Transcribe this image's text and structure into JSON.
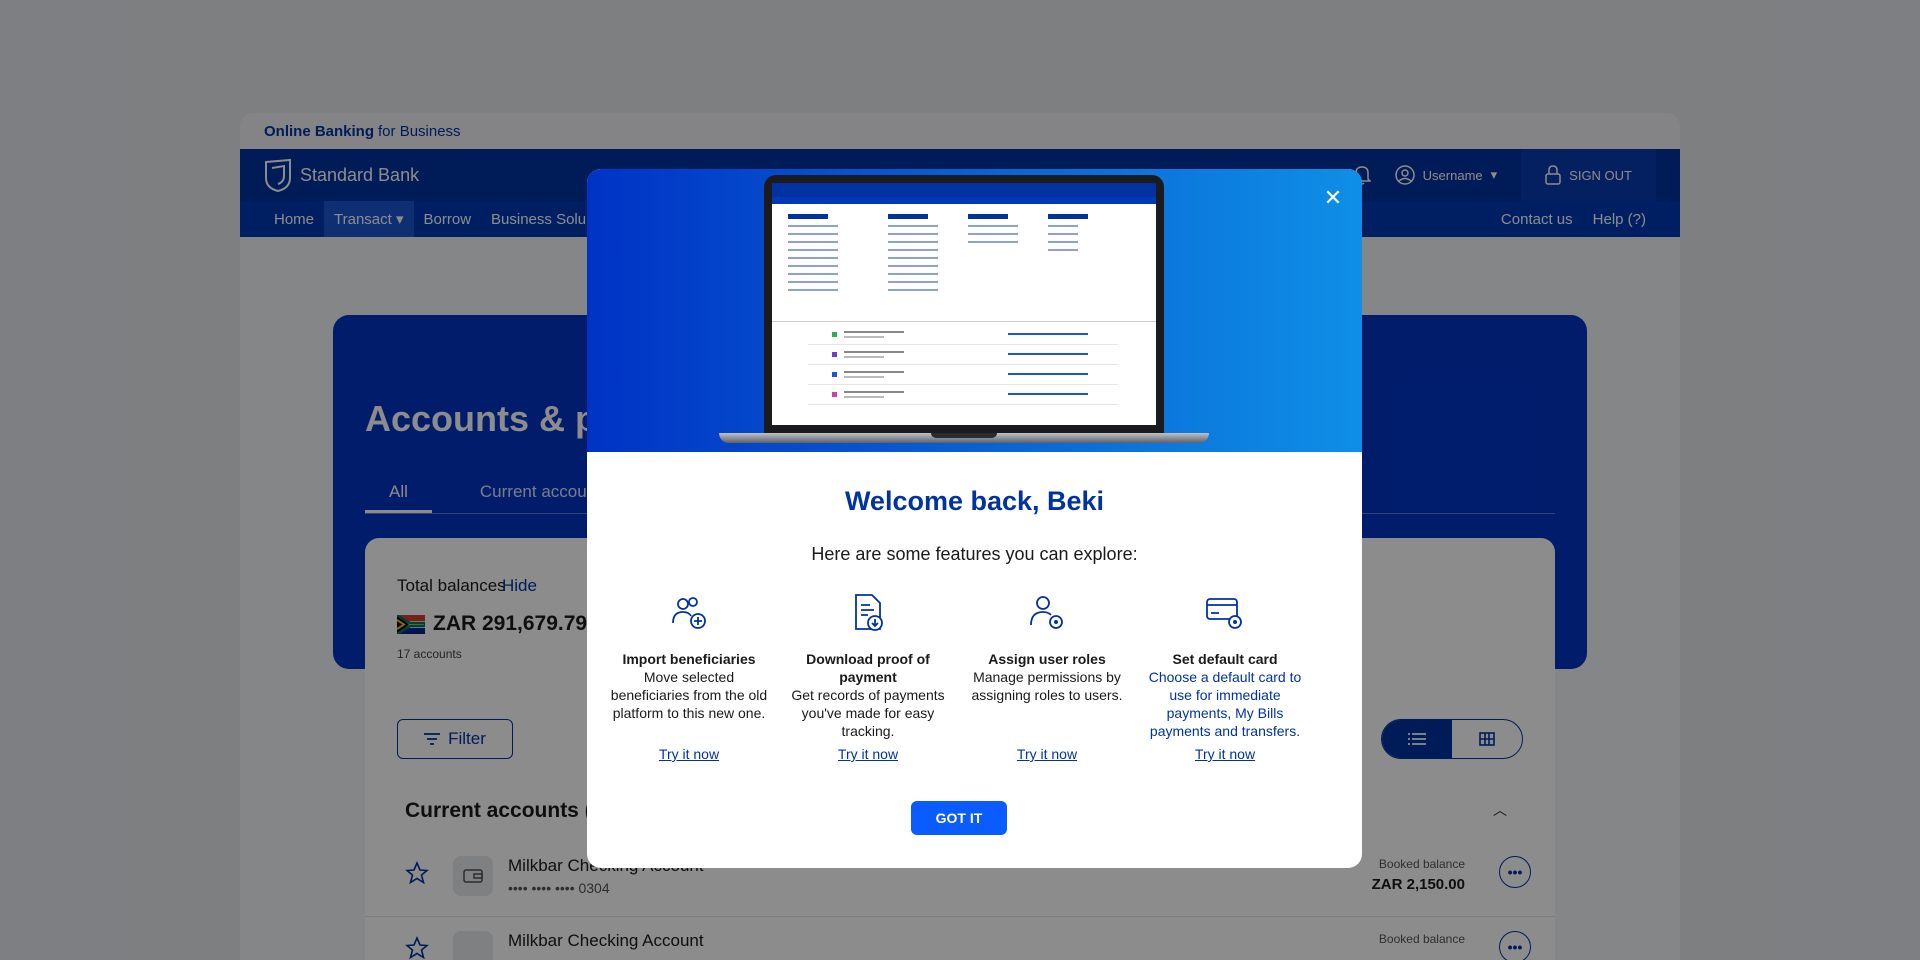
{
  "topstrip": {
    "brand": "Online Banking",
    "suffix": "for Business"
  },
  "header": {
    "bank_name": "Standard Bank",
    "username": "Username",
    "signout": "SIGN OUT"
  },
  "nav": {
    "items": [
      "Home",
      "Transact",
      "Borrow",
      "Business Solu"
    ],
    "right": [
      "Contact us",
      "Help (?)"
    ]
  },
  "page": {
    "title": "Accounts & p",
    "tabs": [
      "All",
      "Current accounts"
    ]
  },
  "balances": {
    "label": "Total balances",
    "hide": "Hide",
    "amount": "ZAR 291,679.79",
    "count": "17 accounts"
  },
  "filter_label": "Filter",
  "current_accounts": {
    "title": "Current accounts (",
    "rows": [
      {
        "name": "Milkbar Checking Account",
        "number": "•••• •••• •••• 0304",
        "balance_label": "Booked balance",
        "balance": "ZAR 2,150.00"
      },
      {
        "name": "Milkbar Checking Account",
        "number": "",
        "balance_label": "Booked balance",
        "balance": ""
      }
    ]
  },
  "modal": {
    "title": "Welcome back, Beki",
    "subtitle": "Here are some features you can explore:",
    "features": [
      {
        "icon": "users-add-icon",
        "title": "Import beneficiaries",
        "desc": "Move selected beneficiaries from the old platform to this new one.",
        "cta": "Try it now"
      },
      {
        "icon": "document-download-icon",
        "title": "Download proof of payment",
        "desc": "Get records of payments you've made for easy tracking.",
        "cta": "Try it now"
      },
      {
        "icon": "user-settings-icon",
        "title": "Assign user roles",
        "desc": "Manage permissions by assigning roles to users.",
        "cta": "Try it now"
      },
      {
        "icon": "card-settings-icon",
        "title": "Set default card",
        "desc": "Choose a default card to use for immediate payments, My Bills payments and transfers.",
        "cta": "Try it now"
      }
    ],
    "confirm": "GOT IT"
  },
  "colors": {
    "brand_blue": "#0033a1",
    "primary_button": "#0a5cff"
  }
}
